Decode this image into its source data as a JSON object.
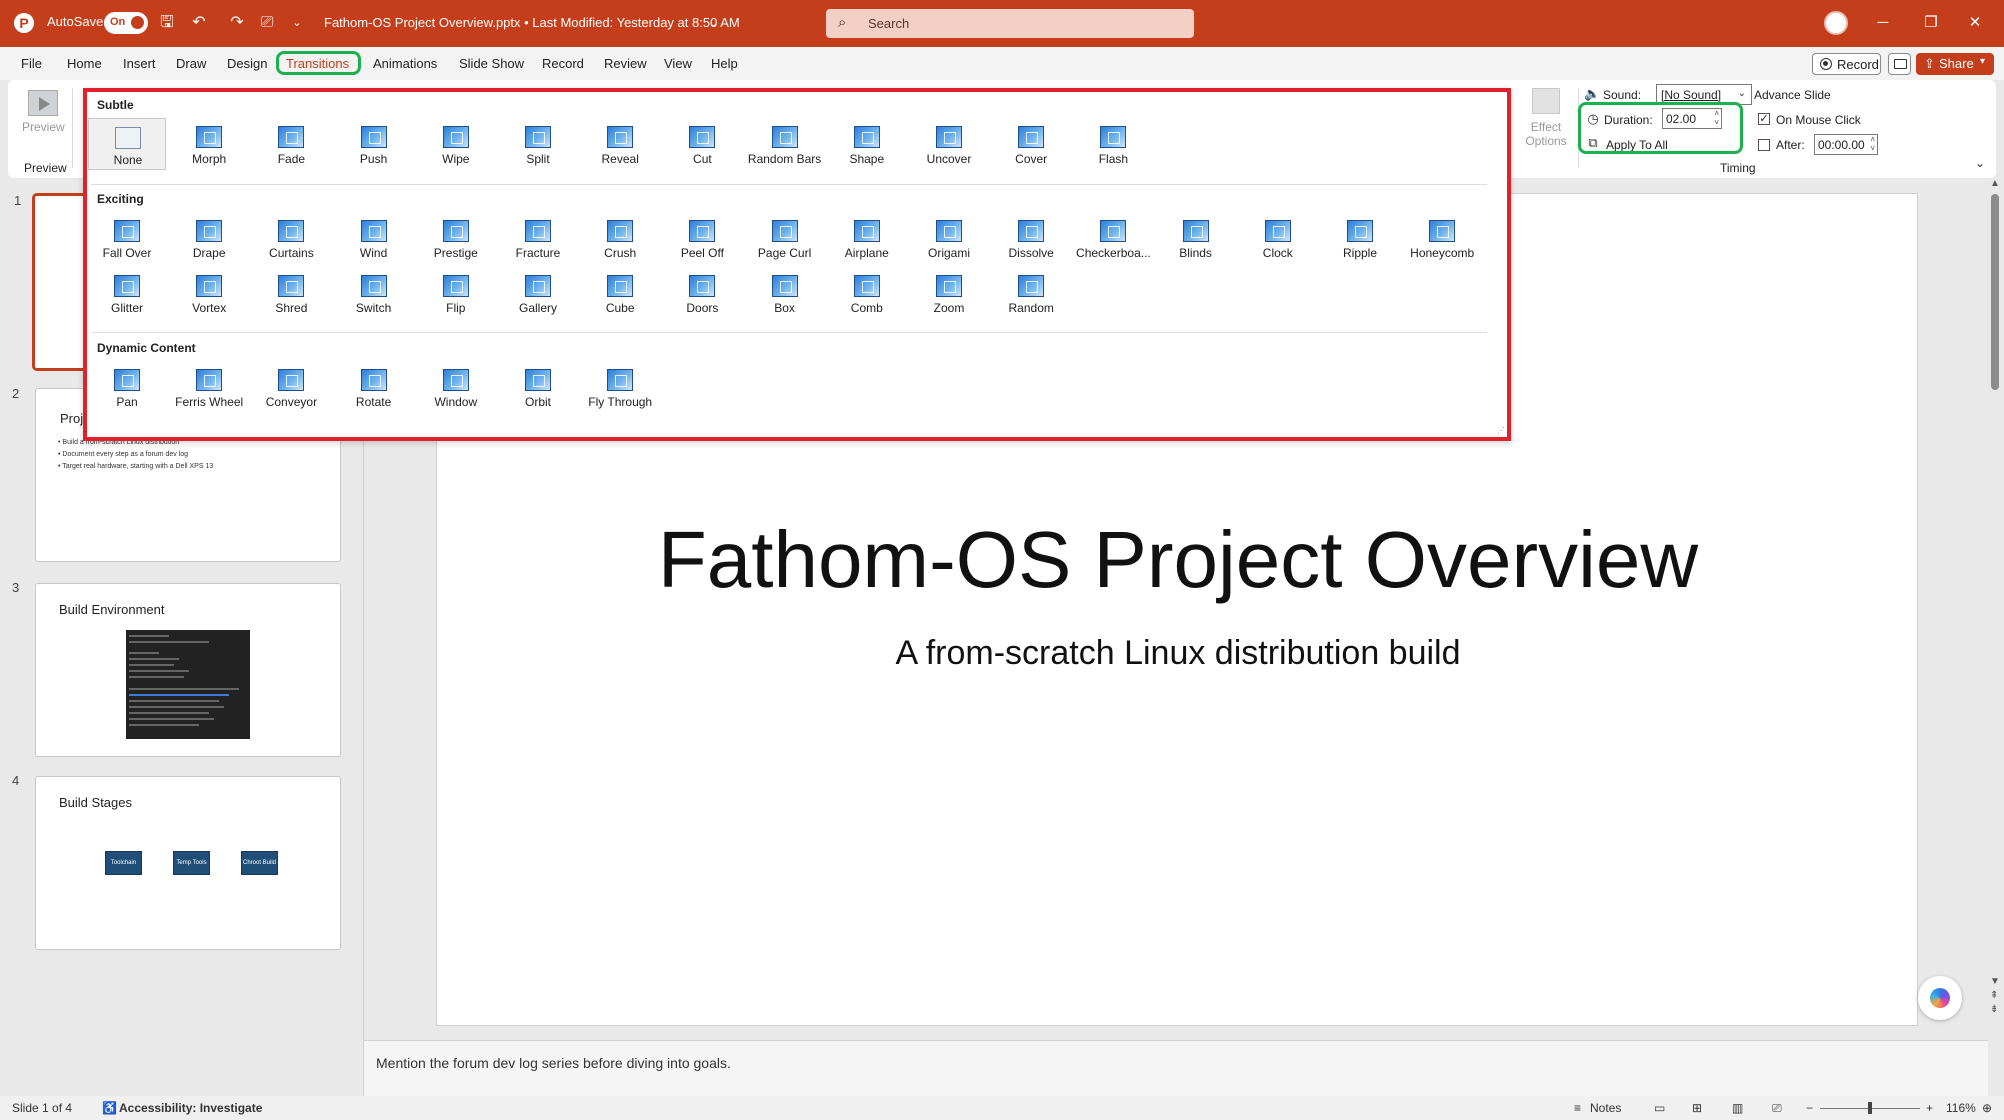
{
  "titlebar": {
    "autosave_label": "AutoSave",
    "autosave_state": "On",
    "document_title": "Fathom-OS Project Overview.pptx • Last Modified: Yesterday at 8:50 AM",
    "title_chevron": "⌄",
    "search_placeholder": "Search",
    "icons": [
      "powerpoint-logo",
      "save-icon",
      "undo-icon",
      "redo-icon",
      "present-icon",
      "customize-icon"
    ],
    "window_buttons": {
      "minimize": "─",
      "restore": "❐",
      "close": "✕"
    }
  },
  "menu": {
    "items": [
      "File",
      "Home",
      "Insert",
      "Draw",
      "Design",
      "Transitions",
      "Animations",
      "Slide Show",
      "Record",
      "Review",
      "View",
      "Help"
    ],
    "active": "Transitions",
    "record_label": "Record",
    "share_label": "Share"
  },
  "ribbon": {
    "preview_label": "Preview",
    "preview_group": "Preview",
    "effect_options": "Effect Options",
    "sound_label": "Sound:",
    "sound_value": "[No Sound]",
    "duration_label": "Duration:",
    "duration_value": "02.00",
    "apply_all": "Apply To All",
    "advance_slide": "Advance Slide",
    "on_mouse_click": "On Mouse Click",
    "on_mouse_click_checked": true,
    "after_label": "After:",
    "after_checked": false,
    "after_value": "00:00.00",
    "timing_group": "Timing"
  },
  "gallery": {
    "sections": [
      {
        "title": "Subtle",
        "items": [
          "None",
          "Morph",
          "Fade",
          "Push",
          "Wipe",
          "Split",
          "Reveal",
          "Cut",
          "Random Bars",
          "Shape",
          "Uncover",
          "Cover",
          "Flash"
        ]
      },
      {
        "title": "Exciting",
        "items": [
          "Fall Over",
          "Drape",
          "Curtains",
          "Wind",
          "Prestige",
          "Fracture",
          "Crush",
          "Peel Off",
          "Page Curl",
          "Airplane",
          "Origami",
          "Dissolve",
          "Checkerboa...",
          "Blinds",
          "Clock",
          "Ripple",
          "Honeycomb",
          "Glitter",
          "Vortex",
          "Shred",
          "Switch",
          "Flip",
          "Gallery",
          "Cube",
          "Doors",
          "Box",
          "Comb",
          "Zoom",
          "Random"
        ]
      },
      {
        "title": "Dynamic Content",
        "items": [
          "Pan",
          "Ferris Wheel",
          "Conveyor",
          "Rotate",
          "Window",
          "Orbit",
          "Fly Through"
        ]
      }
    ],
    "selected": "None"
  },
  "thumbnails": [
    {
      "num": "1",
      "title": ""
    },
    {
      "num": "2",
      "title": "Proj",
      "bullets": [
        "• Build a from-scratch Linux distribution",
        "• Document every step as a forum dev log",
        "• Target real hardware, starting with a Dell XPS 13"
      ]
    },
    {
      "num": "3",
      "title": "Build Environment"
    },
    {
      "num": "4",
      "title": "Build Stages",
      "stages": [
        "Toolchain",
        "Temp Tools",
        "Chroot Build"
      ]
    }
  ],
  "slide": {
    "title": "Fathom-OS Project Overview",
    "subtitle": "A from-scratch Linux distribution build"
  },
  "notes": "Mention the forum dev log series before diving into goals.",
  "status": {
    "slide_counter": "Slide 1 of 4",
    "accessibility": "Accessibility: Investigate",
    "notes_label": "Notes",
    "zoom_minus": "−",
    "zoom_plus": "+",
    "zoom_level": "116%"
  }
}
